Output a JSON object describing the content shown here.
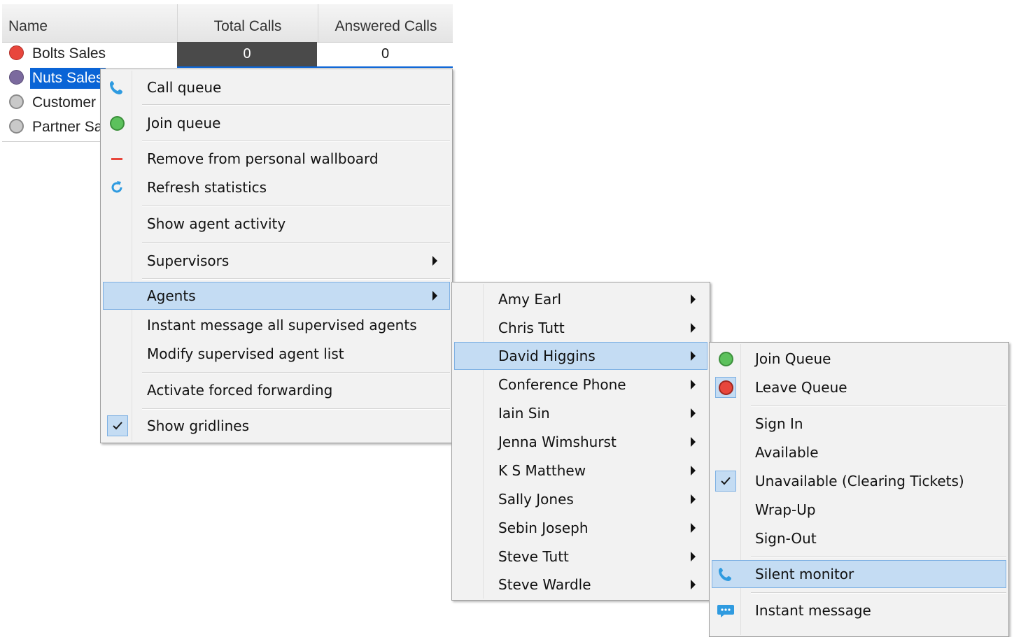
{
  "grid": {
    "columns": [
      "Name",
      "Total Calls",
      "Answered Calls"
    ],
    "rows": [
      {
        "name": "Bolts Sales",
        "status_color": "#e8463c",
        "total": "0",
        "answered": "0",
        "selected": false
      },
      {
        "name": "Nuts Sales",
        "status_color": "#7b6a9e",
        "total": "",
        "answered": "",
        "selected": true
      },
      {
        "name": "Customer",
        "status_color": "#b9b9b9",
        "total": "",
        "answered": "",
        "selected": false
      },
      {
        "name": "Partner Sales",
        "status_color": "#b9b9b9",
        "total": "",
        "answered": "",
        "selected": false
      }
    ]
  },
  "context_menu": {
    "items": [
      {
        "label": "Call queue",
        "icon": "phone-icon"
      },
      {
        "label": "Join queue",
        "icon": "green-status-icon"
      },
      {
        "label": "Remove from personal wallboard",
        "icon": "remove-icon"
      },
      {
        "label": "Refresh statistics",
        "icon": "refresh-icon"
      },
      {
        "label": "Show agent activity",
        "icon": ""
      },
      {
        "label": "Supervisors",
        "icon": "",
        "submenu": true
      },
      {
        "label": "Agents",
        "icon": "",
        "submenu": true,
        "highlighted": true
      },
      {
        "label": "Instant message all supervised agents",
        "icon": ""
      },
      {
        "label": "Modify supervised agent list",
        "icon": ""
      },
      {
        "label": "Activate forced forwarding",
        "icon": ""
      },
      {
        "label": "Show gridlines",
        "icon": "checkmark-icon",
        "checked": true
      }
    ]
  },
  "agents_menu": {
    "items": [
      "Amy Earl",
      "Chris Tutt",
      "David Higgins",
      "Conference Phone",
      "Iain Sin",
      "Jenna Wimshurst",
      "K S Matthew",
      "Sally Jones",
      "Sebin Joseph",
      "Steve Tutt",
      "Steve Wardle"
    ],
    "highlighted": "David Higgins"
  },
  "agent_actions_menu": {
    "items": [
      {
        "label": "Join Queue",
        "icon": "green-status-icon"
      },
      {
        "label": "Leave Queue",
        "icon": "red-status-icon"
      },
      {
        "label": "Sign In",
        "icon": ""
      },
      {
        "label": "Available",
        "icon": ""
      },
      {
        "label": "Unavailable (Clearing Tickets)",
        "icon": "checkmark-icon",
        "checked": true
      },
      {
        "label": "Wrap-Up",
        "icon": ""
      },
      {
        "label": "Sign-Out",
        "icon": ""
      },
      {
        "label": "Silent monitor",
        "icon": "phone-icon",
        "highlighted": true
      },
      {
        "label": "Instant message",
        "icon": "chat-icon"
      }
    ]
  },
  "colors": {
    "highlight": "#c4dcf3",
    "highlight_border": "#7fb1e3",
    "selection": "#0a64d6",
    "green_status": "#5cc15c",
    "red_status": "#e8463c",
    "phone_icon": "#2f9be0"
  }
}
